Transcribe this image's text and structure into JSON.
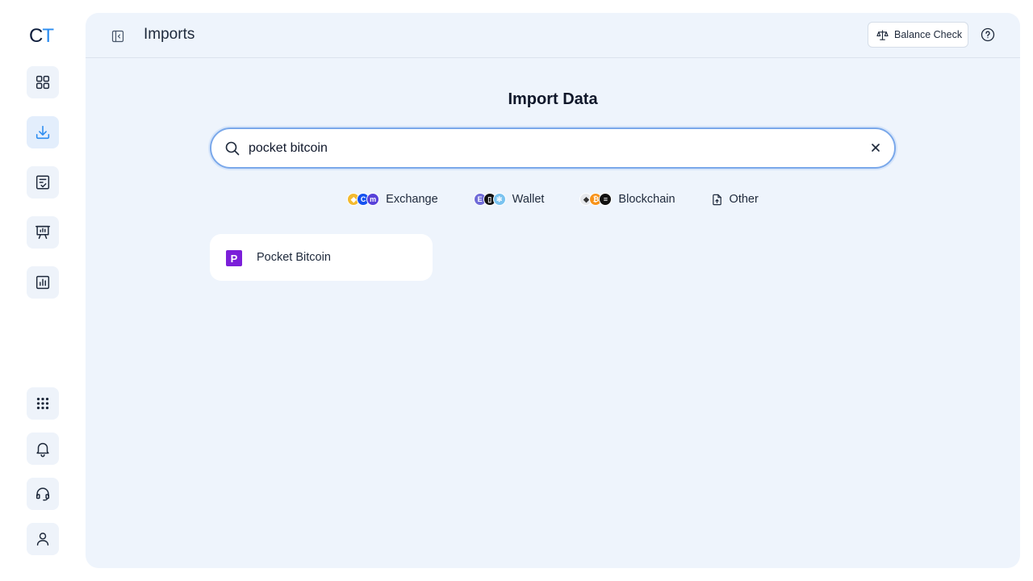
{
  "logo": {
    "c": "C",
    "t": "T"
  },
  "sidebar": {
    "items": [
      {
        "name": "dashboard",
        "icon": "grid-icon"
      },
      {
        "name": "imports",
        "icon": "download-icon",
        "active": true
      },
      {
        "name": "transactions",
        "icon": "checklist-icon"
      },
      {
        "name": "reports",
        "icon": "presentation-icon"
      },
      {
        "name": "analytics",
        "icon": "chart-icon"
      },
      {
        "name": "apps",
        "icon": "dots-grid-icon"
      },
      {
        "name": "notifications",
        "icon": "bell-icon"
      },
      {
        "name": "support",
        "icon": "headset-icon"
      },
      {
        "name": "profile",
        "icon": "user-icon"
      }
    ]
  },
  "header": {
    "title": "Imports",
    "balance_check_label": "Balance Check"
  },
  "main": {
    "heading": "Import Data",
    "search": {
      "value": "pocket bitcoin",
      "placeholder": "Search"
    },
    "filters": [
      {
        "label": "Exchange"
      },
      {
        "label": "Wallet"
      },
      {
        "label": "Blockchain"
      },
      {
        "label": "Other"
      }
    ],
    "results": [
      {
        "name": "Pocket Bitcoin",
        "logo_letter": "P"
      }
    ]
  },
  "colors": {
    "accent": "#2b8cf0",
    "pocket_bitcoin": "#7b1fd9"
  }
}
